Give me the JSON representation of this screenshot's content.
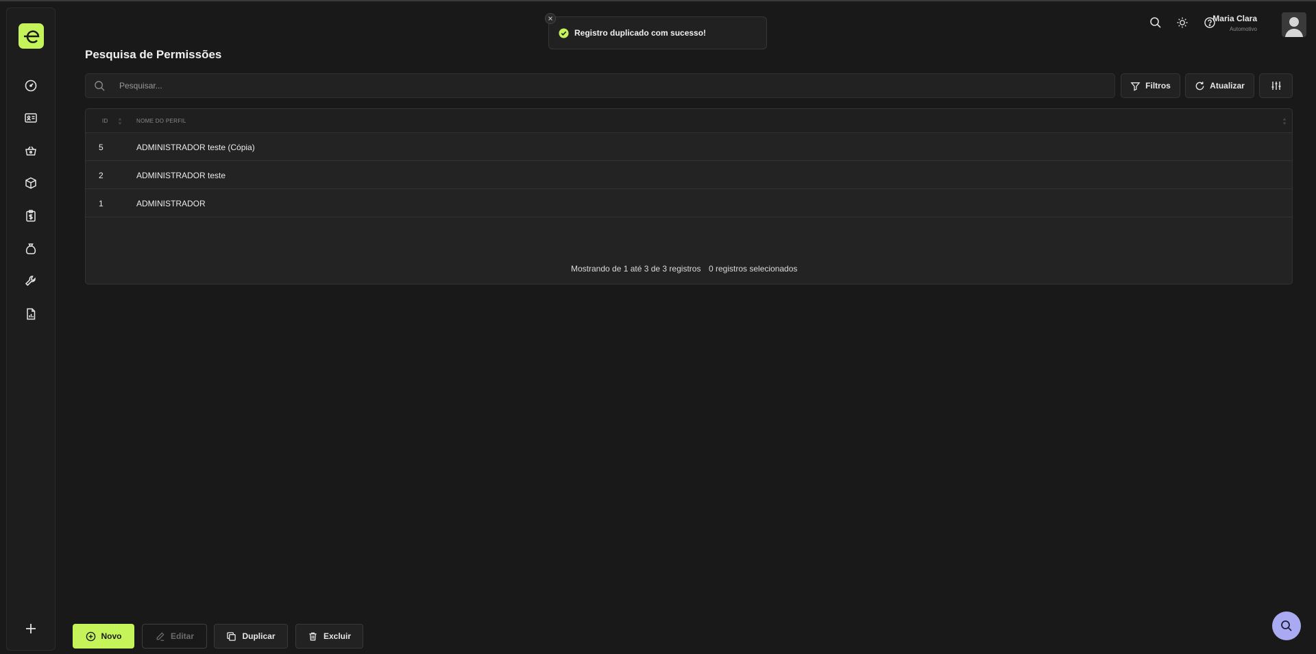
{
  "toast": {
    "message": "Registro duplicado com sucesso!"
  },
  "header": {
    "user_name": "Maria Clara",
    "user_role": "Automotivo"
  },
  "page": {
    "title": "Pesquisa de Permissões"
  },
  "toolbar": {
    "search_placeholder": "Pesquisar...",
    "filters_label": "Filtros",
    "refresh_label": "Atualizar"
  },
  "table": {
    "columns": [
      "ID",
      "Nome do Perfil"
    ],
    "rows": [
      {
        "id": "5",
        "name": "ADMINISTRADOR teste (Cópia)"
      },
      {
        "id": "2",
        "name": "ADMINISTRADOR teste"
      },
      {
        "id": "1",
        "name": "ADMINISTRADOR"
      }
    ],
    "footer_showing": "Mostrando de 1 até 3 de 3 registros",
    "footer_selected": "0 registros selecionados"
  },
  "actions": {
    "new_label": "Novo",
    "edit_label": "Editar",
    "duplicate_label": "Duplicar",
    "delete_label": "Excluir"
  },
  "colors": {
    "accent": "#c5f35a",
    "background": "#191919",
    "fab": "#a9aaf2"
  },
  "icons": {
    "sidebar": [
      "dashboard-icon",
      "contact-card-icon",
      "basket-icon",
      "box-icon",
      "clipboard-dollar-icon",
      "money-bag-icon",
      "wrench-icon",
      "report-icon"
    ]
  }
}
